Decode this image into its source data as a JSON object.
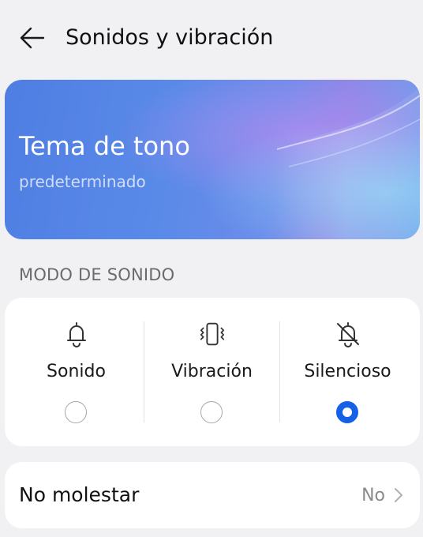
{
  "header": {
    "title": "Sonidos y vibración",
    "back_icon": "arrow-left-icon"
  },
  "banner": {
    "title": "Tema de tono",
    "subtitle": "predeterminado",
    "accent_color": "#5a8ae8"
  },
  "sound_mode": {
    "section_label": "MODO DE SONIDO",
    "options": [
      {
        "label": "Sonido",
        "icon": "bell-icon",
        "selected": false
      },
      {
        "label": "Vibración",
        "icon": "vibrate-icon",
        "selected": false
      },
      {
        "label": "Silencioso",
        "icon": "bell-off-icon",
        "selected": true
      }
    ],
    "selected_color": "#1561e6"
  },
  "do_not_disturb": {
    "label": "No molestar",
    "value": "No",
    "icon": "chevron-right-icon"
  }
}
